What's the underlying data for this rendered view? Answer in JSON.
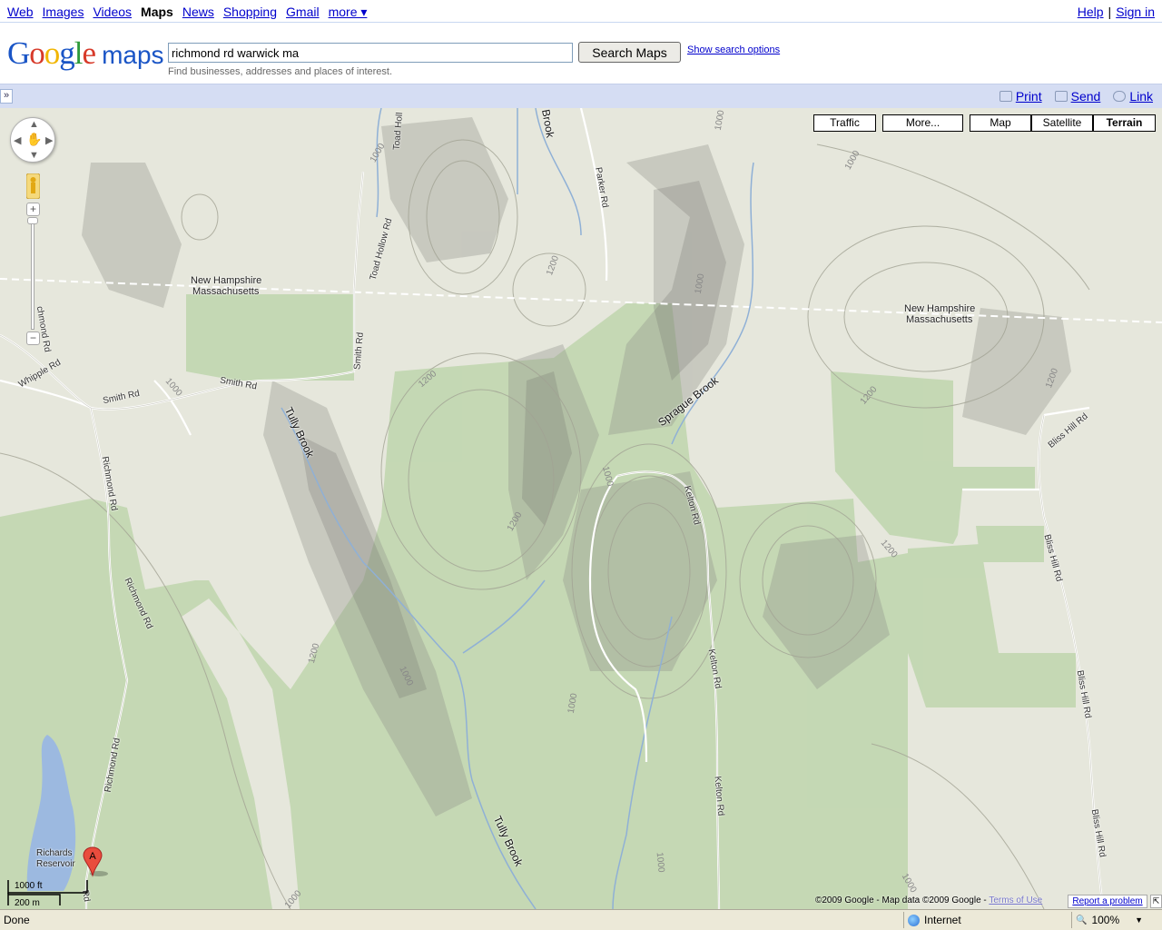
{
  "topnav": {
    "links": [
      "Web",
      "Images",
      "Videos"
    ],
    "current": "Maps",
    "links_after": [
      "News",
      "Shopping",
      "Gmail"
    ],
    "more": "more ▾",
    "help": "Help",
    "separator": "|",
    "signin": "Sign in"
  },
  "header": {
    "logo_google": [
      "G",
      "o",
      "o",
      "g",
      "l",
      "e"
    ],
    "logo_maps": "maps",
    "search_value": "richmond rd warwick ma",
    "search_button": "Search Maps",
    "search_options": "Show search options",
    "search_hint": "Find businesses, addresses and places of interest."
  },
  "toolbar": {
    "collapse": "»",
    "print": "Print",
    "send": "Send",
    "link": "Link"
  },
  "map": {
    "type_buttons": {
      "traffic": "Traffic",
      "more": "More...",
      "map": "Map",
      "satellite": "Satellite",
      "terrain": "Terrain"
    },
    "active_type": "Terrain",
    "scale": {
      "feet": "1000 ft",
      "meters": "200 m"
    },
    "copyright": "©2009 Google - Map data ©2009 Google - ",
    "terms": "Terms of Use",
    "report": "Report a problem",
    "marker_label": "A",
    "labels": {
      "nh_west": "New Hampshire",
      "ma_west": "Massachusetts",
      "nh_east": "New Hampshire",
      "ma_east": "Massachusetts",
      "richards": "Richards",
      "reservoir": "Reservoir"
    },
    "roads": {
      "toad_hollow": "Toad Hollow Rd",
      "toad_holl": "Toad Holl",
      "parker": "Parker Rd",
      "smith_a": "Smith Rd",
      "smith_b": "Smith Rd",
      "smith_c": "Smith Rd",
      "whipple": "Whipple Rd",
      "richmond_a": "Richmond Rd",
      "richmond_b": "Richmond Rd",
      "richmond_c": "Richmond Rd",
      "richmond_d": "chmond Rd",
      "kelton_a": "Kelton Rd",
      "kelton_b": "Kelton Rd",
      "kelton_c": "Kelton Rd",
      "bliss_a": "Bliss Hill Rd",
      "bliss_b": "Bliss Hill Rd",
      "bliss_c": "Bliss Hill Rd",
      "bliss_d": "Bliss Hill Rd",
      "rd": "Rd"
    },
    "water": {
      "tully_a": "Tully Brook",
      "tully_b": "Tully Brook",
      "sprague": "Sprague Brook",
      "brook_top": "Brook"
    },
    "elevations": [
      "1000",
      "1000",
      "1000",
      "1200",
      "1200",
      "1200",
      "1200",
      "1000",
      "1200",
      "1200",
      "1000",
      "1000",
      "1000",
      "1000",
      "1000",
      "1000",
      "1000",
      "1200"
    ]
  },
  "statusbar": {
    "status": "Done",
    "zone": "Internet",
    "zoom": "100%"
  }
}
